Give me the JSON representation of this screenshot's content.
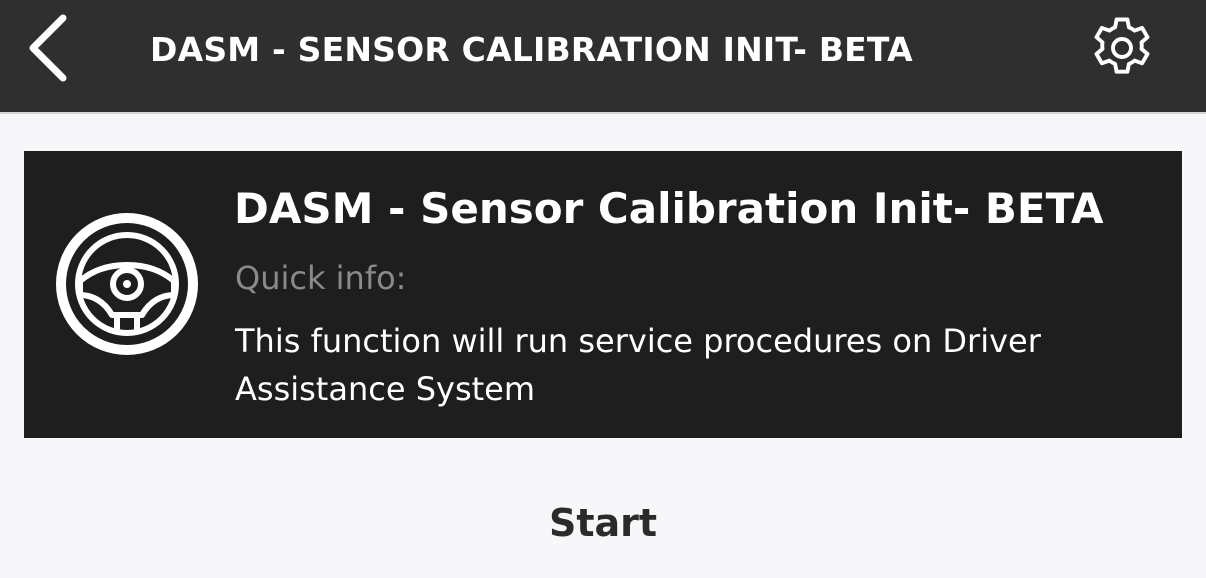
{
  "header": {
    "title": "DASM - SENSOR CALIBRATION INIT- BETA",
    "back_icon": "chevron-left-icon",
    "settings_icon": "gear-icon"
  },
  "card": {
    "icon": "steering-wheel-icon",
    "title": "DASM - Sensor Calibration Init- BETA",
    "subtitle": "Quick info:",
    "description": "This function will run service procedures on Driver Assistance System"
  },
  "actions": {
    "start_label": "Start"
  },
  "colors": {
    "topbar_bg": "#2f2f2f",
    "card_bg": "#1e1e1e",
    "page_bg": "#f7f7f9",
    "muted_text": "#8a8a8a"
  }
}
